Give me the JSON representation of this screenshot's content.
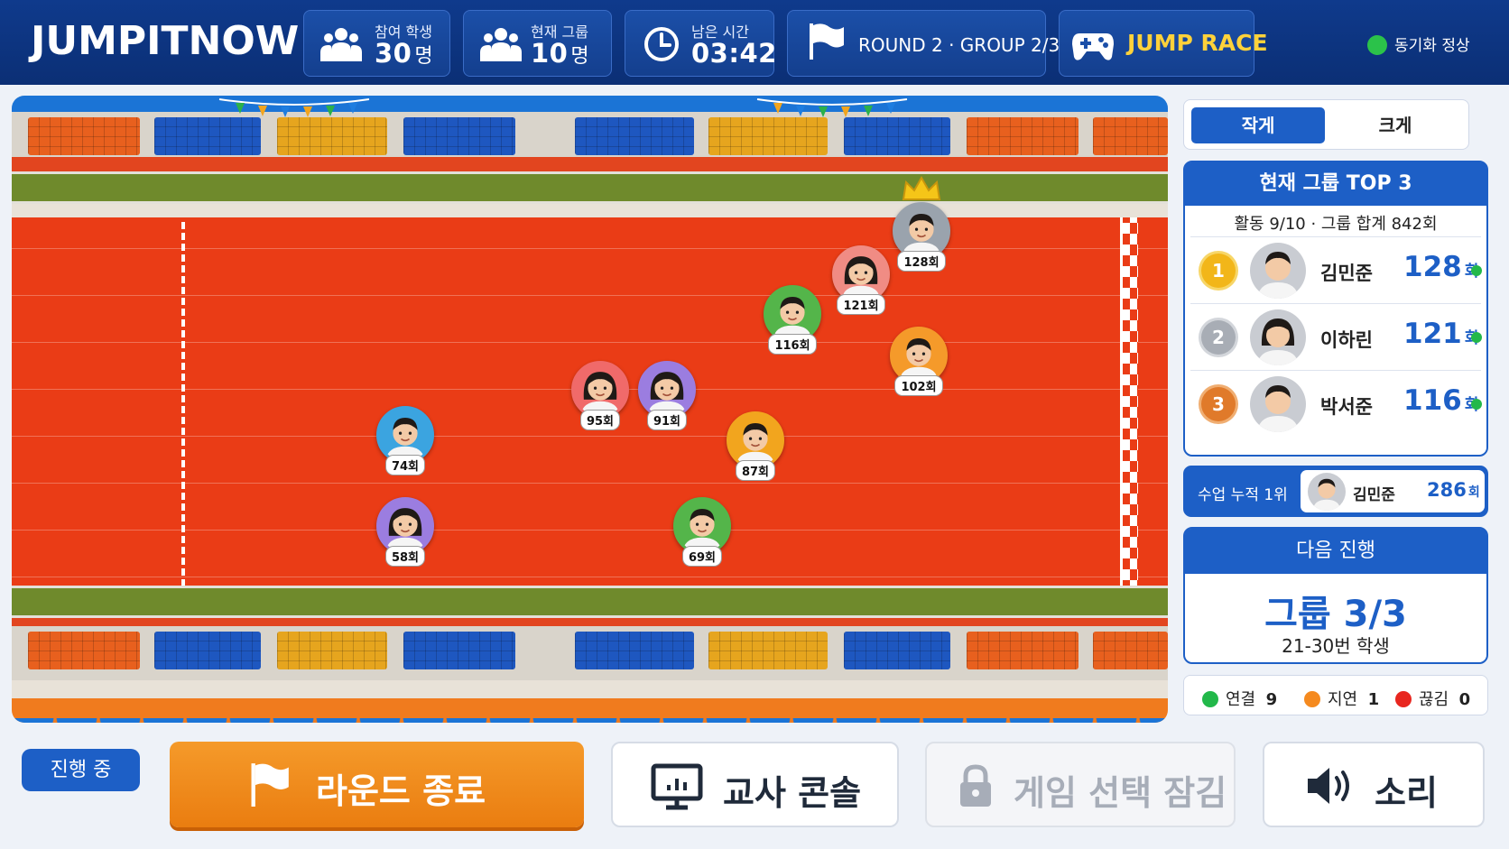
{
  "header": {
    "logo": "JUMPITNOW",
    "participants": {
      "label": "참여 학생",
      "value": "30",
      "unit": "명"
    },
    "current_group": {
      "label": "현재 그룹",
      "value": "10",
      "unit": "명"
    },
    "time_left": {
      "label": "남은 시간",
      "value": "03:42"
    },
    "round": "ROUND 2 · GROUP 2/3",
    "game": "JUMP RACE",
    "sync": "동기화 정상"
  },
  "runners": [
    {
      "label": "128회",
      "ring": "#9aa3ad",
      "crown": true
    },
    {
      "label": "121회",
      "ring": "#f08c84"
    },
    {
      "label": "116회",
      "ring": "#54b54a"
    },
    {
      "label": "102회",
      "ring": "#f59a2a"
    },
    {
      "label": "95회",
      "ring": "#f06a6a"
    },
    {
      "label": "91회",
      "ring": "#9b7de0"
    },
    {
      "label": "87회",
      "ring": "#f2a51e"
    },
    {
      "label": "74회",
      "ring": "#3ba4e0"
    },
    {
      "label": "58회",
      "ring": "#9b7de0"
    },
    {
      "label": "69회",
      "ring": "#54b54a"
    }
  ],
  "panel": {
    "size_small": "작게",
    "size_large": "크게",
    "top3_title": "현재 그룹 TOP 3",
    "summary": "활동 9/10  ·  그룹 합계 842회",
    "ranks": [
      {
        "rank": "1",
        "name": "김민준",
        "score": "128",
        "unit": "회"
      },
      {
        "rank": "2",
        "name": "이하린",
        "score": "121",
        "unit": "회"
      },
      {
        "rank": "3",
        "name": "박서준",
        "score": "116",
        "unit": "회"
      }
    ],
    "cumulative": {
      "label": "수업 누적 1위",
      "name": "김민준",
      "score": "286",
      "unit": "회"
    },
    "next_title": "다음 진행",
    "next_group": "그룹 3/3",
    "next_sub": "21-30번 학생",
    "connection": {
      "connected_label": "연결",
      "connected": "9",
      "delayed_label": "지연",
      "delayed": "1",
      "lost_label": "끊김",
      "lost": "0"
    }
  },
  "bottom": {
    "status": "진행 중",
    "end_round": "라운드 종료",
    "teacher_console": "교사 콘솔",
    "game_lock": "게임 선택 잠김",
    "sound": "소리"
  },
  "colors": {
    "brand": "#1d5fc6",
    "header": "#0f3a8c",
    "accent": "#ea7d10",
    "track": "#ea3c16"
  }
}
